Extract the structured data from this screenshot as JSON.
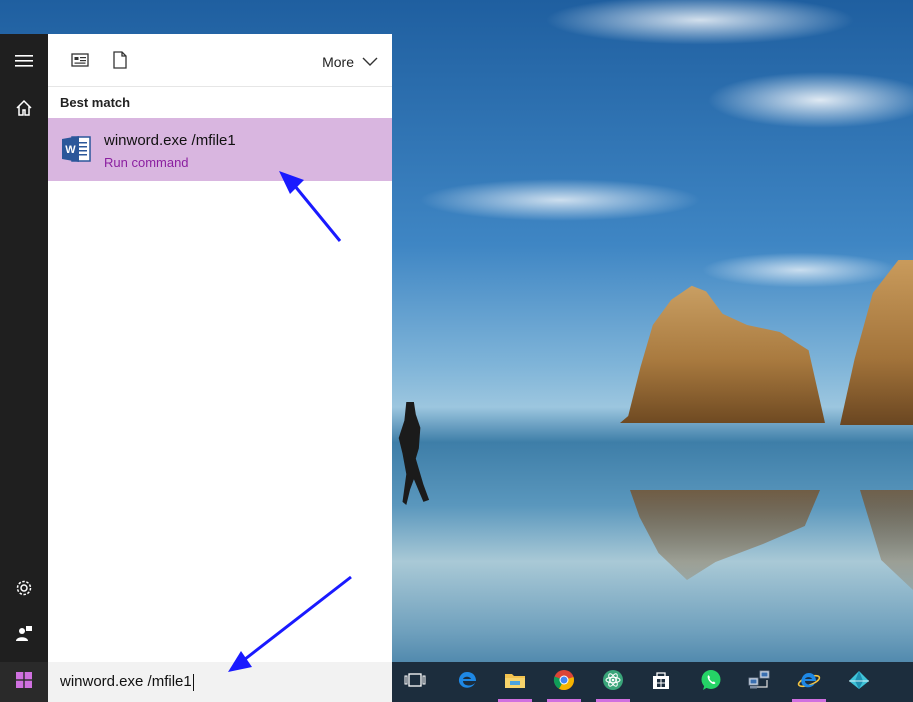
{
  "start_menu": {
    "rail": {
      "menu_icon": "hamburger-icon",
      "home_icon": "home-icon",
      "settings_icon": "gear-icon",
      "user_icon": "user-feedback-icon"
    },
    "toolbar": {
      "apps_filter_icon": "apps-filter-icon",
      "documents_filter_icon": "document-icon",
      "more_label": "More"
    },
    "section_heading": "Best match",
    "best_match": {
      "title": "winword.exe /mfile1",
      "subtitle": "Run command",
      "icon": "word-icon",
      "highlight_color": "#d9b6e0"
    }
  },
  "search": {
    "value": "winword.exe /mfile1"
  },
  "taskbar": {
    "start_icon": "windows-start-icon",
    "items": [
      {
        "icon": "task-view-icon"
      },
      {
        "icon": "edge-icon"
      },
      {
        "icon": "file-explorer-icon"
      },
      {
        "icon": "chrome-icon"
      },
      {
        "icon": "atom-icon"
      },
      {
        "icon": "store-icon"
      },
      {
        "icon": "whatsapp-icon"
      },
      {
        "icon": "network-icon"
      },
      {
        "icon": "internet-explorer-icon"
      },
      {
        "icon": "app-diamond-icon"
      }
    ]
  },
  "colors": {
    "accent": "#d070e0",
    "arrow": "#1a1aff",
    "rail_bg": "#1f1f1f",
    "taskbar_bg": "#1c2d3d"
  }
}
